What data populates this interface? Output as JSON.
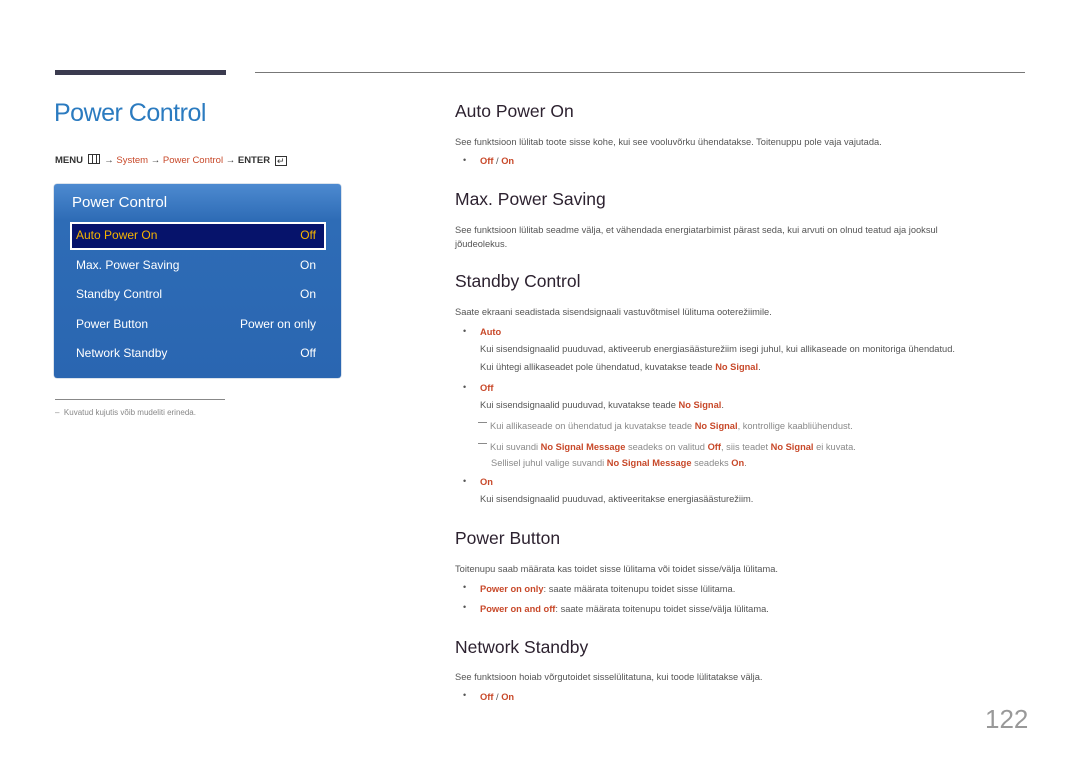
{
  "page": {
    "title": "Power Control",
    "page_number": "122"
  },
  "breadcrumb": {
    "menu": "MENU",
    "arrow": "→",
    "system": "System",
    "power_control": "Power Control",
    "enter": "ENTER"
  },
  "osd": {
    "title": "Power Control",
    "items": [
      {
        "label": "Auto Power On",
        "value": "Off",
        "selected": true
      },
      {
        "label": "Max. Power Saving",
        "value": "On"
      },
      {
        "label": "Standby Control",
        "value": "On"
      },
      {
        "label": "Power Button",
        "value": "Power on only"
      },
      {
        "label": "Network Standby",
        "value": "Off"
      }
    ]
  },
  "footnote": "Kuvatud kujutis võib mudeliti erineda.",
  "sections": {
    "auto_power_on": {
      "heading": "Auto Power On",
      "desc": "See funktsioon lülitab toote sisse kohe, kui see vooluvõrku ühendatakse. Toitenuppu pole vaja vajutada.",
      "opt_off": "Off",
      "sep": " / ",
      "opt_on": "On"
    },
    "max_power_saving": {
      "heading": "Max. Power Saving",
      "desc1": "See funktsioon lülitab seadme välja, et vähendada energiatarbimist pärast seda, kui arvuti on olnud teatud aja jooksul",
      "desc2": "jõudeolekus."
    },
    "standby_control": {
      "heading": "Standby Control",
      "desc": "Saate ekraani seadistada sisendsignaali vastuvõtmisel lülituma ooterežiimile.",
      "auto": {
        "label": "Auto",
        "line1": "Kui sisendsignaalid puuduvad, aktiveerub energiasäästurežiim isegi juhul, kui allikaseade on monitoriga ühendatud.",
        "line2_pre": "Kui ühtegi allikaseadet pole ühendatud, kuvatakse teade ",
        "line2_hl": "No Signal",
        "line2_post": "."
      },
      "off": {
        "label": "Off",
        "line1_pre": "Kui sisendsignaalid puuduvad, kuvatakse teade ",
        "line1_hl": "No Signal",
        "line1_post": ".",
        "note1_pre": "Kui allikaseade on ühendatud ja kuvatakse teade ",
        "note1_hl": "No Signal",
        "note1_post": ", kontrollige kaabliühendust.",
        "note2_a": "Kui suvandi ",
        "note2_b": "No Signal Message",
        "note2_c": " seadeks on valitud ",
        "note2_d": "Off",
        "note2_e": ", siis teadet ",
        "note2_f": "No Signal",
        "note2_g": " ei kuvata.",
        "note3_a": "Sellisel juhul valige suvandi ",
        "note3_b": "No Signal Message",
        "note3_c": " seadeks ",
        "note3_d": "On",
        "note3_e": "."
      },
      "on": {
        "label": "On",
        "line1": "Kui sisendsignaalid puuduvad, aktiveeritakse energiasäästurežiim."
      }
    },
    "power_button": {
      "heading": "Power Button",
      "desc": "Toitenupu saab määrata kas toidet sisse lülitama või toidet sisse/välja lülitama.",
      "opt1_label": "Power on only",
      "opt1_text": ": saate määrata toitenupu toidet sisse lülitama.",
      "opt2_label": "Power on and off",
      "opt2_text": ": saate määrata toitenupu toidet sisse/välja lülitama."
    },
    "network_standby": {
      "heading": "Network Standby",
      "desc": "See funktsioon hoiab võrgutoidet sisselülitatuna, kui toode lülitatakse välja.",
      "opt_off": "Off",
      "sep": " / ",
      "opt_on": "On"
    }
  },
  "colors": {
    "title_blue": "#2b7bc0",
    "highlight_orange": "#c8492a",
    "osd_blue": "#2a66b1",
    "osd_selected_bg": "#06136b",
    "osd_selected_text": "#f6b400"
  }
}
